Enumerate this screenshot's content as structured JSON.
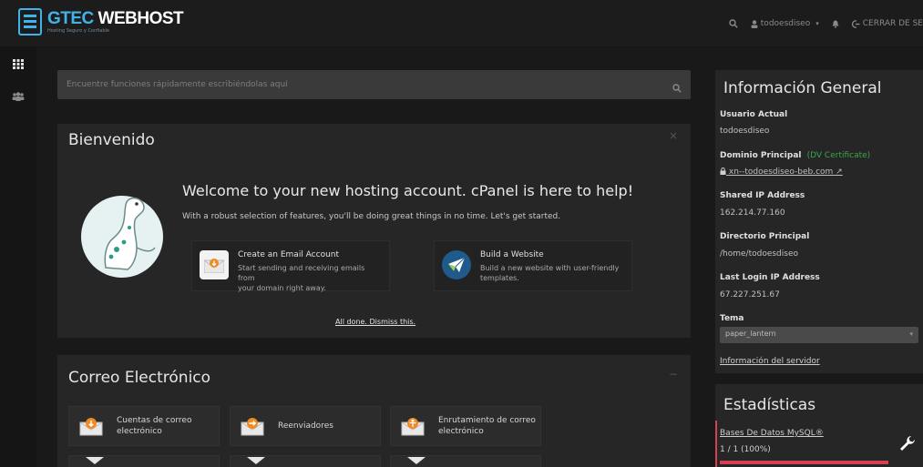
{
  "brand": {
    "title_accent": "GTEC",
    "title_main": " WEBHOST",
    "subtitle": "Hosting Seguro y Confiable"
  },
  "topbar": {
    "user": "todoesdiseo",
    "logout": "CERRAR DE SE"
  },
  "search": {
    "placeholder": "Encuentre funciones rápidamente escribiéndolas aquí"
  },
  "welcome": {
    "title": "Bienvenido",
    "close": "×",
    "headline": "Welcome to your new hosting account. cPanel is here to help!",
    "subtext": "With a robust selection of features, you'll be doing great things in no time. Let's get started.",
    "cards": [
      {
        "title": "Create an Email Account",
        "desc_line1": "Start sending and receiving emails from",
        "desc_line2": "your domain right away."
      },
      {
        "title": "Build a Website",
        "desc_line1": "Build a new website with user-friendly",
        "desc_line2": "templates."
      }
    ],
    "dismiss": "All done. Dismiss this."
  },
  "email": {
    "title": "Correo Electrónico",
    "collapse": "−",
    "tools": [
      {
        "line1": "Cuentas de correo",
        "line2": "electrónico"
      },
      {
        "line1": "Reenviadores",
        "line2": ""
      },
      {
        "line1": "Enrutamiento de correo",
        "line2": "electrónico"
      }
    ]
  },
  "info": {
    "title": "Información General",
    "user_label": "Usuario Actual",
    "user_value": "todoesdiseo",
    "domain_label": "Dominio Principal",
    "domain_badge": "(DV Certificate)",
    "domain_value": "xn--todoesdiseo-beb.com",
    "ip_label": "Shared IP Address",
    "ip_value": "162.214.77.160",
    "dir_label": "Directorio Principal",
    "dir_value": "/home/todoesdiseo",
    "last_ip_label": "Last Login IP Address",
    "last_ip_value": "67.227.251.67",
    "theme_label": "Tema",
    "theme_value": "paper_lantern",
    "server_link": "Información del servidor"
  },
  "stats": {
    "title": "Estadísticas",
    "db_label": "Bases De Datos MySQL®",
    "db_value": "1 / 1   (100%)",
    "db_fraction": 1.0
  },
  "colors": {
    "accent_blue": "#3fb3ea",
    "alert_red": "#d64050",
    "green_badge": "#3aa845",
    "orange_icon": "#f08a24"
  }
}
